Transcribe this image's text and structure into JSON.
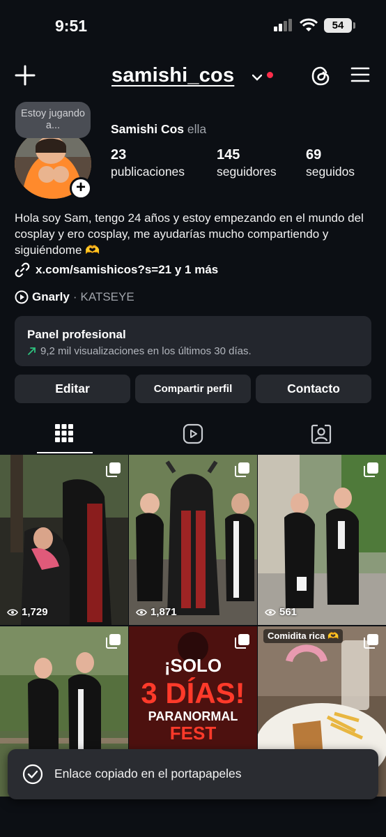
{
  "status_bar": {
    "time": "9:51",
    "battery": "54"
  },
  "header": {
    "username": "samishi_cos"
  },
  "profile": {
    "note": "Estoy jugando a...",
    "display_name": "Samishi Cos",
    "pronoun": "ella",
    "stats": [
      {
        "value": "23",
        "label": "publicaciones"
      },
      {
        "value": "145",
        "label": "seguidores"
      },
      {
        "value": "69",
        "label": "seguidos"
      }
    ],
    "bio": "Hola soy Sam, tengo 24 años y estoy empezando en el mundo del cosplay y ero cosplay, me ayudarías mucho compartiendo y siguiéndome 🫶",
    "link": "x.com/samishicos?s=21 y 1 más",
    "music": {
      "song": "Gnarly",
      "separator": "·",
      "artist": "KATSEYE"
    }
  },
  "panel": {
    "title": "Panel profesional",
    "subtitle": "9,2 mil visualizaciones en los últimos 30 días."
  },
  "buttons": {
    "edit": "Editar",
    "share": "Compartir perfil",
    "contact": "Contacto"
  },
  "tabs": [
    {
      "icon": "grid-icon",
      "active": true
    },
    {
      "icon": "reels-icon",
      "active": false
    },
    {
      "icon": "tagged-icon",
      "active": false
    }
  ],
  "grid": [
    {
      "views": "1,729",
      "multi": true
    },
    {
      "views": "1,871",
      "multi": true
    },
    {
      "views": "561",
      "multi": true
    },
    {
      "views": "",
      "multi": true
    },
    {
      "views": "",
      "multi": true,
      "poster": {
        "line1": "¡SOLO",
        "line2": "3 DÍAS!",
        "line3": "PARANORMAL",
        "line4": "FEST"
      }
    },
    {
      "views": "",
      "multi": true,
      "caption": "Comidita rica 🫶"
    }
  ],
  "toast": {
    "message": "Enlace copiado en el portapapeles"
  },
  "colors": {
    "background": "#0c0f14",
    "card": "#23262d",
    "button": "#26292f",
    "notification_dot": "#ff2d4a",
    "growth_arrow": "#2ec27e"
  }
}
